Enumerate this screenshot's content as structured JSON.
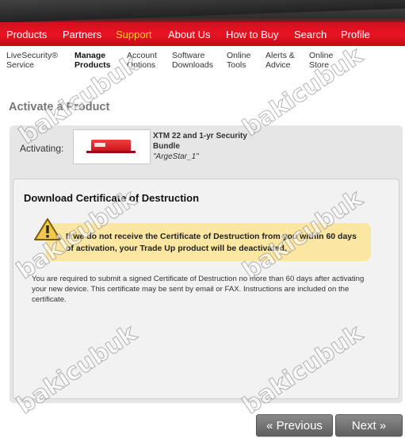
{
  "top_nav": {
    "items": [
      {
        "label": "Products",
        "active": false
      },
      {
        "label": "Partners",
        "active": false
      },
      {
        "label": "Support",
        "active": true
      },
      {
        "label": "About Us",
        "active": false
      },
      {
        "label": "How to Buy",
        "active": false
      },
      {
        "label": "Search",
        "active": false
      },
      {
        "label": "Profile",
        "active": false
      }
    ],
    "active_color": "#ffd42a",
    "band_color": "#e4101f"
  },
  "sub_nav": {
    "items": [
      {
        "line1": "LiveSecurity®",
        "line2": "Service",
        "active": false
      },
      {
        "line1": "Manage",
        "line2": "Products",
        "active": true
      },
      {
        "line1": "Account",
        "line2": "Options",
        "active": false
      },
      {
        "line1": "Software",
        "line2": "Downloads",
        "active": false
      },
      {
        "line1": "Online",
        "line2": "Tools",
        "active": false
      },
      {
        "line1": "Alerts &",
        "line2": "Advice",
        "active": false
      },
      {
        "line1": "Online",
        "line2": "Store",
        "active": false
      }
    ]
  },
  "page": {
    "title": "Activate a Product",
    "activating_label": "Activating:",
    "product": {
      "name": "XTM 22 and 1-yr Security Bundle",
      "alias": "\"ArgeStar_1\"",
      "icon": "firewall-device-icon"
    }
  },
  "card": {
    "title": "Download Certificate of Destruction",
    "warning": {
      "icon": "warning-triangle-icon",
      "text": "If we do not receive the Certificate of Destruction from you within 60 days of activation, your Trade Up product will be deactivated.",
      "background": "#fbe6a2"
    },
    "body": "You are required to submit a signed Certificate of Destruction no more than 60 days after activating your new device. This certificate may be sent by email or FAX. Instructions are included on the certificate."
  },
  "buttons": {
    "previous": "« Previous",
    "next": "Next »"
  },
  "watermark": "bakicubuk"
}
